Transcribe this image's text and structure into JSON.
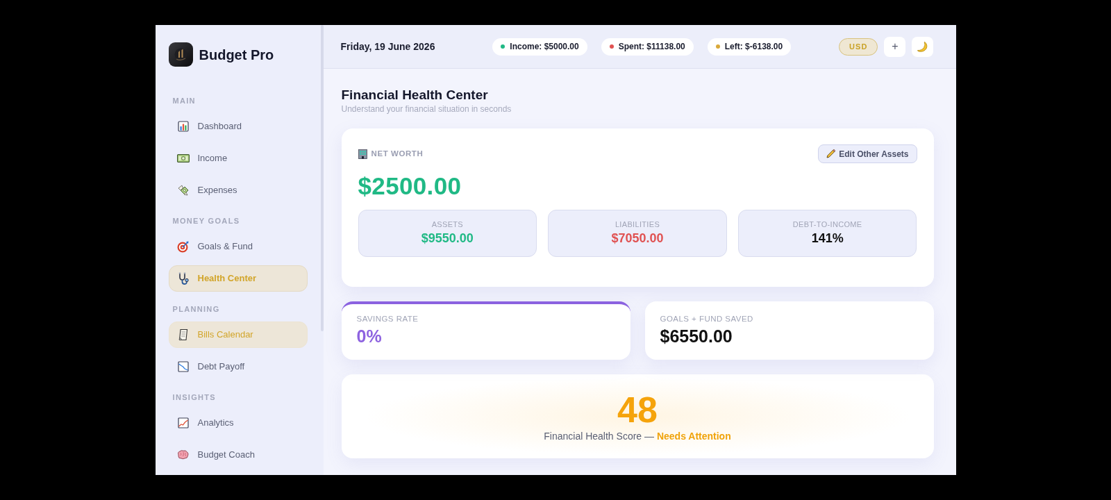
{
  "sidebar": {
    "brand": "Budget Pro",
    "sections": [
      {
        "title": "MAIN",
        "items": [
          {
            "label": "Dashboard",
            "selected": false,
            "hovered": false
          },
          {
            "label": "Income",
            "selected": false,
            "hovered": false
          },
          {
            "label": "Expenses",
            "selected": false,
            "hovered": false
          }
        ]
      },
      {
        "title": "MONEY GOALS",
        "items": [
          {
            "label": "Goals & Fund",
            "selected": false,
            "hovered": false
          },
          {
            "label": "Health Center",
            "selected": true,
            "hovered": false
          }
        ]
      },
      {
        "title": "PLANNING",
        "items": [
          {
            "label": "Bills Calendar",
            "selected": false,
            "hovered": true
          },
          {
            "label": "Debt Payoff",
            "selected": false,
            "hovered": false
          }
        ]
      },
      {
        "title": "INSIGHTS",
        "items": [
          {
            "label": "Analytics",
            "selected": false,
            "hovered": false
          },
          {
            "label": "Budget Coach",
            "selected": false,
            "hovered": false
          }
        ]
      }
    ]
  },
  "header": {
    "date": "Friday, 19 June 2026",
    "pills": [
      {
        "label": "Income: $5000.00",
        "color": "#20b985"
      },
      {
        "label": "Spent: $11138.00",
        "color": "#e05252"
      },
      {
        "label": "Left: $-6138.00",
        "color": "#d9a93a"
      }
    ],
    "currency": "USD",
    "add_button": "+"
  },
  "page": {
    "title": "Financial Health Center",
    "subtitle": "Understand your financial situation in seconds"
  },
  "net_worth": {
    "label": "NET WORTH",
    "edit_button": "Edit Other Assets",
    "value": "$2500.00",
    "stats": [
      {
        "label": "ASSETS",
        "value": "$9550.00",
        "color": "#20b985"
      },
      {
        "label": "LIABILITIES",
        "value": "$7050.00",
        "color": "#e05252"
      },
      {
        "label": "DEBT-TO-INCOME",
        "value": "141%",
        "color": "#111111"
      }
    ]
  },
  "summary_cards": [
    {
      "label": "SAVINGS RATE",
      "value": "0%",
      "kind": "accent"
    },
    {
      "label": "GOALS + FUND SAVED",
      "value": "$6550.00",
      "kind": "plain"
    }
  ],
  "health_score": {
    "score": "48",
    "caption": "Financial Health Score — **Needs Attention**"
  }
}
